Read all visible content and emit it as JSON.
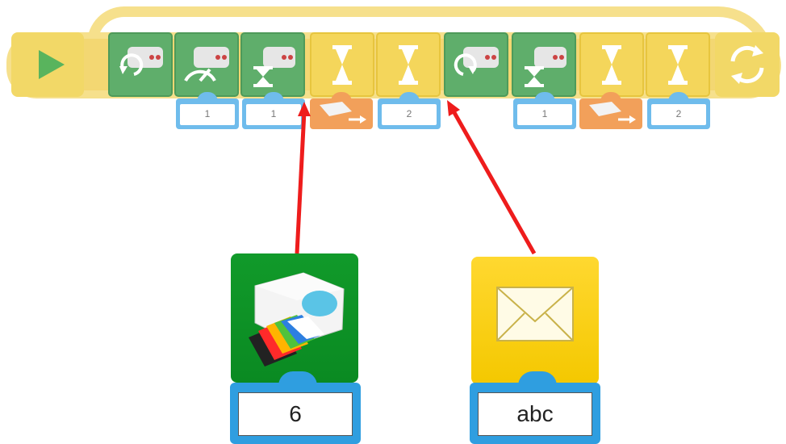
{
  "sequence": {
    "blocks": [
      {
        "kind": "motor-anticlockwise",
        "color": "green"
      },
      {
        "kind": "motor-power",
        "color": "green"
      },
      {
        "kind": "motor-on-for",
        "color": "green"
      },
      {
        "kind": "wait-for",
        "color": "yellow"
      },
      {
        "kind": "wait-for",
        "color": "yellow"
      },
      {
        "kind": "motor-clockwise",
        "color": "green"
      },
      {
        "kind": "motor-on-for",
        "color": "green"
      },
      {
        "kind": "wait-for",
        "color": "yellow"
      },
      {
        "kind": "wait-for",
        "color": "yellow"
      }
    ],
    "params": [
      {
        "value": "1"
      },
      {
        "value": "1"
      },
      {
        "kind": "tilt-sensor-input"
      },
      {
        "value": "2"
      },
      {
        "value": "1"
      },
      {
        "kind": "tilt-sensor-input"
      },
      {
        "value": "2"
      }
    ]
  },
  "color_sensor_block": {
    "value": "6"
  },
  "message_block": {
    "value": "abc"
  },
  "colors": {
    "loop": "#f6e08c",
    "green_block": "#5fae6b",
    "yellow_block": "#f4d65b",
    "number_input": "#6fbcec",
    "sensor_input": "#f2a05a",
    "arrow": "#ee1c1c"
  }
}
